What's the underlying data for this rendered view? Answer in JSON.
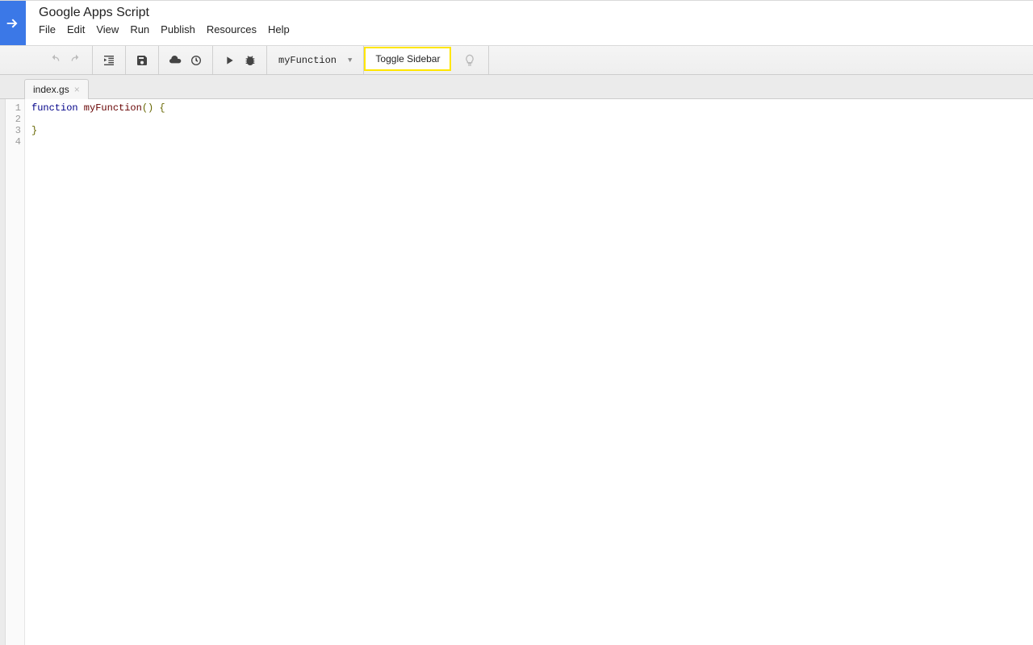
{
  "header": {
    "app_title": "Google Apps Script",
    "menu": [
      "File",
      "Edit",
      "View",
      "Run",
      "Publish",
      "Resources",
      "Help"
    ]
  },
  "toolbar": {
    "function_selected": "myFunction",
    "toggle_sidebar_label": "Toggle Sidebar"
  },
  "tabs": {
    "active": "index.gs"
  },
  "editor": {
    "line_numbers": [
      "1",
      "2",
      "3",
      "4"
    ],
    "code": {
      "l1_kw": "function",
      "l1_fn": " myFunction",
      "l1_rest": "() {",
      "l2": "  ",
      "l3": "}",
      "l4": ""
    }
  }
}
